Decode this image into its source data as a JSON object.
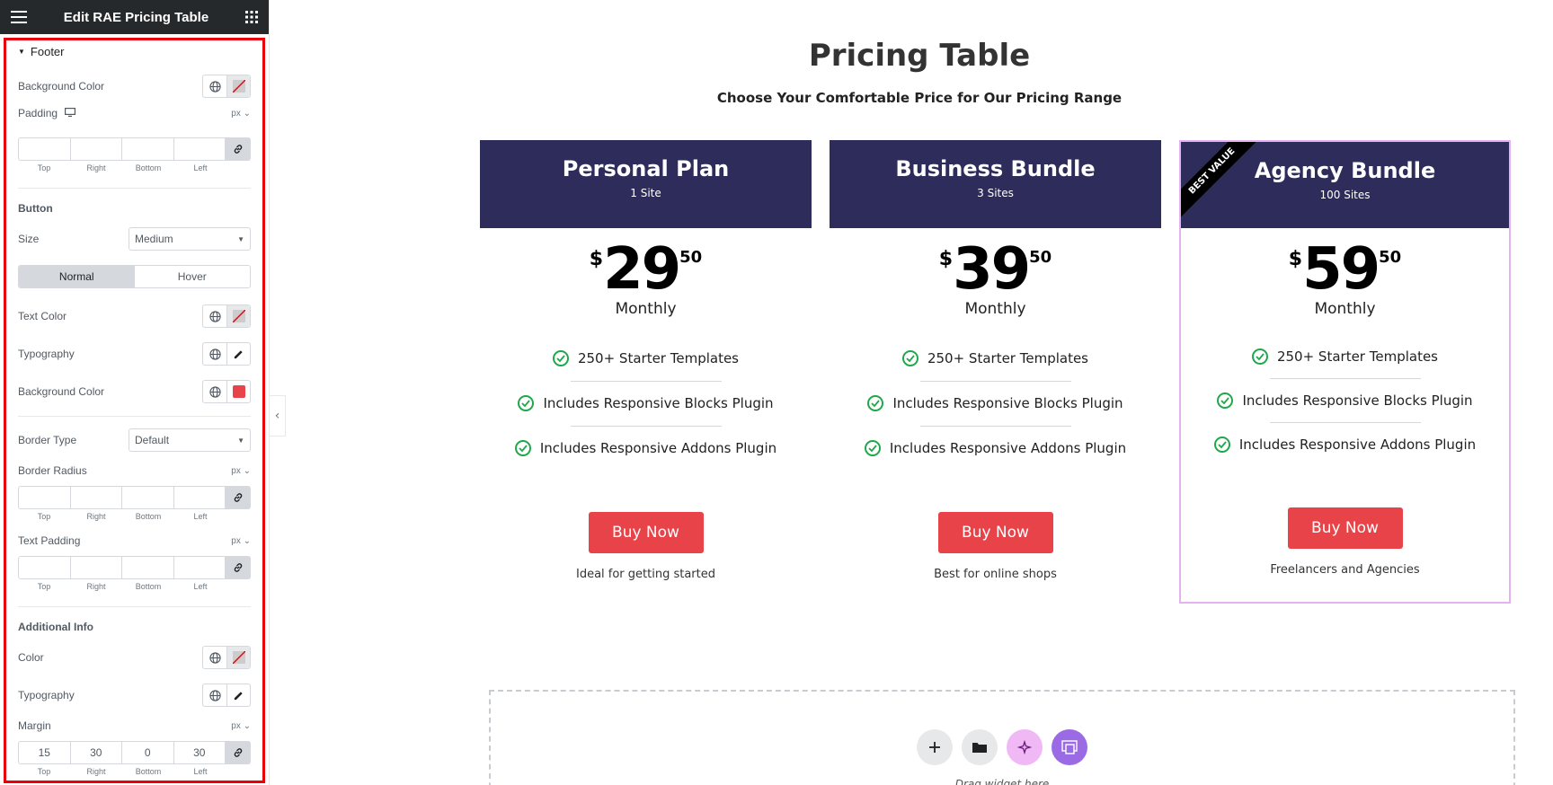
{
  "editor": {
    "title": "Edit RAE Pricing Table",
    "section": "Footer",
    "footer": {
      "bg_label": "Background Color",
      "padding_label": "Padding",
      "padding_unit": "px",
      "dim_labels": [
        "Top",
        "Right",
        "Bottom",
        "Left"
      ]
    },
    "button": {
      "heading": "Button",
      "size_label": "Size",
      "size_value": "Medium",
      "tab_normal": "Normal",
      "tab_hover": "Hover",
      "text_color_label": "Text Color",
      "typography_label": "Typography",
      "bg_label": "Background Color",
      "bg_color": "#e84348",
      "border_type_label": "Border Type",
      "border_type_value": "Default",
      "border_radius_label": "Border Radius",
      "border_radius_unit": "px",
      "text_padding_label": "Text Padding",
      "text_padding_unit": "px"
    },
    "additional": {
      "heading": "Additional Info",
      "color_label": "Color",
      "typography_label": "Typography",
      "margin_label": "Margin",
      "margin_unit": "px",
      "margin_values": [
        "15",
        "30",
        "0",
        "30"
      ]
    }
  },
  "canvas": {
    "title": "Pricing Table",
    "subtitle": "Choose Your Comfortable Price for Our Pricing Range",
    "plans": [
      {
        "name": "Personal Plan",
        "sites": "1 Site",
        "currency": "$",
        "amount": "29",
        "cents": "50",
        "period": "Monthly",
        "features": [
          "250+ Starter Templates",
          "Includes Responsive Blocks Plugin",
          "Includes Responsive Addons Plugin"
        ],
        "button": "Buy Now",
        "info": "Ideal for getting started"
      },
      {
        "name": "Business Bundle",
        "sites": "3 Sites",
        "currency": "$",
        "amount": "39",
        "cents": "50",
        "period": "Monthly",
        "features": [
          "250+ Starter Templates",
          "Includes Responsive Blocks Plugin",
          "Includes Responsive Addons Plugin"
        ],
        "button": "Buy Now",
        "info": "Best for online shops"
      },
      {
        "name": "Agency Bundle",
        "sites": "100 Sites",
        "ribbon": "BEST VALUE",
        "currency": "$",
        "amount": "59",
        "cents": "50",
        "period": "Monthly",
        "features": [
          "250+ Starter Templates",
          "Includes Responsive Blocks Plugin",
          "Includes Responsive Addons Plugin"
        ],
        "button": "Buy Now",
        "info": "Freelancers and Agencies"
      }
    ],
    "dropzone_text": "Drag widget here"
  },
  "colors": {
    "header_bg": "#2d2c5a",
    "button_bg": "#e84348",
    "highlight_border": "#e4b3ef",
    "check": "#1fa84a",
    "panel_outline": "#e8000b"
  }
}
